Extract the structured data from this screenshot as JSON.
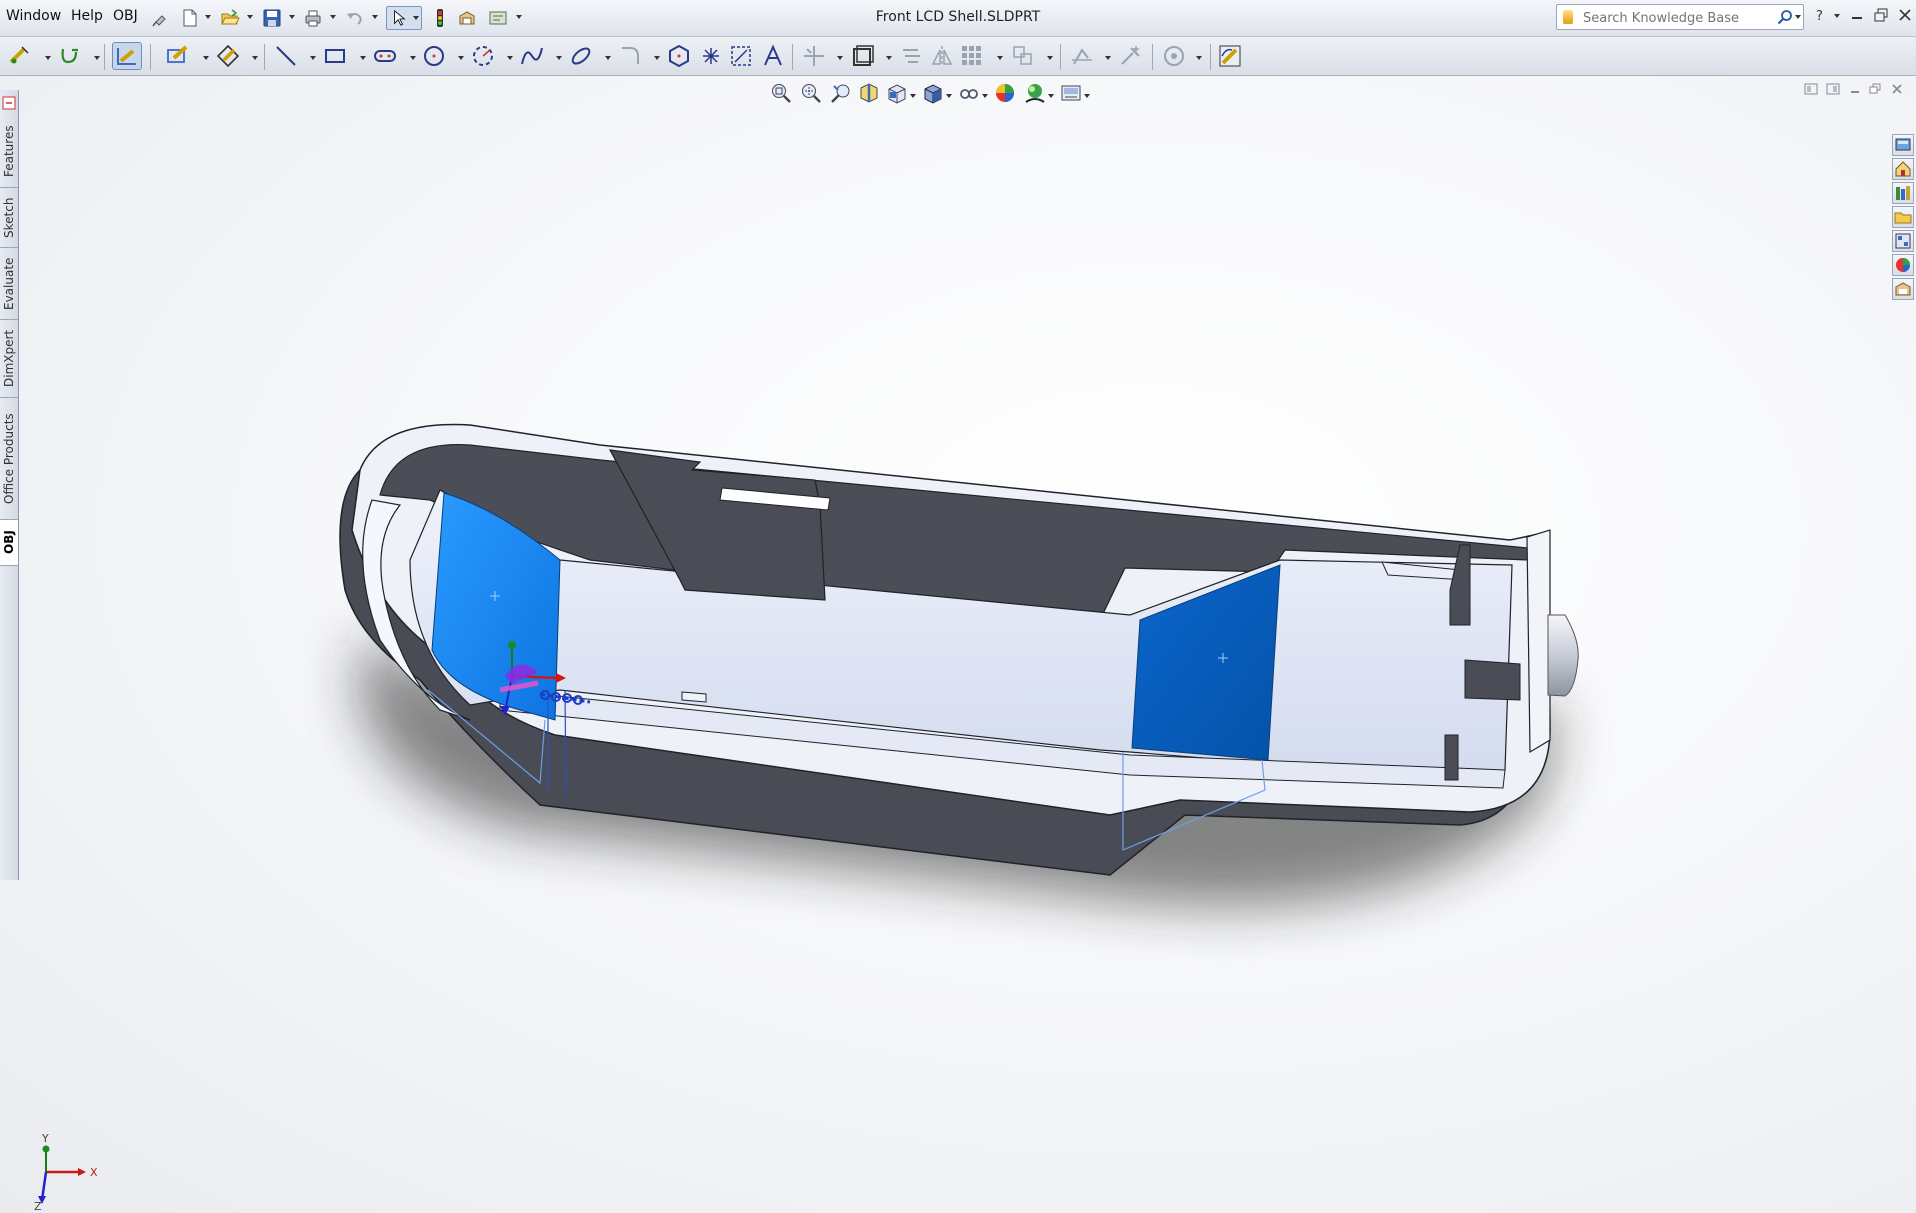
{
  "window": {
    "title": "Front LCD Shell.SLDPRT"
  },
  "menu": {
    "items": [
      {
        "label": "Window"
      },
      {
        "label": "Help"
      },
      {
        "label": "OBJ"
      }
    ]
  },
  "search": {
    "placeholder": "Search Knowledge Base"
  },
  "left_tabs": [
    {
      "label": "Features"
    },
    {
      "label": "Sketch"
    },
    {
      "label": "Evaluate"
    },
    {
      "label": "DimXpert"
    },
    {
      "label": "Office Products"
    },
    {
      "label": "OBJ",
      "active": true
    }
  ],
  "triad": {
    "x_label": "X",
    "y_label": "Y",
    "z_label": "Z"
  },
  "colors": {
    "accent": "#1e7fe6",
    "selected_face_light": "#1a8cff",
    "selected_face_dark": "#0058b8",
    "model_dark": "#4a4d55",
    "model_light": "#dde3f3",
    "model_edge": "#1f2228"
  },
  "icons": {
    "quick_access": [
      "new-document-icon",
      "open-folder-icon",
      "save-icon",
      "print-icon",
      "undo-icon",
      "select-arrow-icon",
      "rebuild-icon",
      "file-properties-icon",
      "options-icon"
    ],
    "sketch_tools": [
      "smart-dimension-icon",
      "trim-icon",
      "sketch-icon",
      "3d-sketch-icon",
      "line-icon",
      "rectangle-icon",
      "slot-icon",
      "circle-icon",
      "arc-icon",
      "spline-icon",
      "ellipse-icon",
      "fillet-icon",
      "polygon-icon",
      "point-icon",
      "convert-entities-icon",
      "text-icon",
      "trim-entities-icon",
      "offset-icon",
      "mirror-icon",
      "linear-pattern-icon",
      "move-entities-icon",
      "display-relations-icon",
      "repair-sketch-icon",
      "quick-snaps-icon",
      "instant-2d-icon"
    ],
    "heads_up": [
      "zoom-to-fit-icon",
      "zoom-to-area-icon",
      "previous-view-icon",
      "section-view-icon",
      "view-orientation-icon",
      "display-style-icon",
      "hide-show-icon",
      "edit-appearance-icon",
      "apply-scene-icon",
      "view-settings-icon"
    ]
  }
}
